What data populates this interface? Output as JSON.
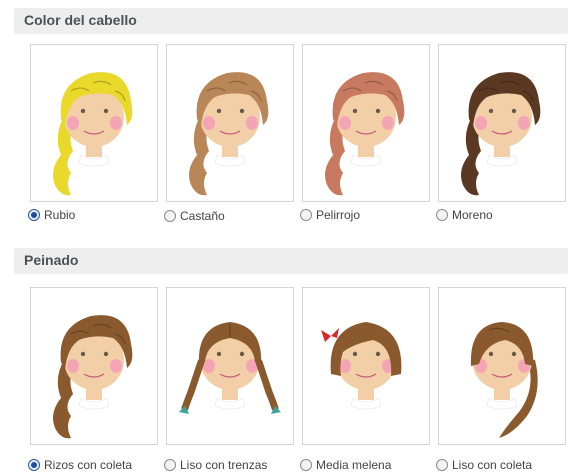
{
  "sections": [
    {
      "title": "Color del cabello",
      "options": [
        {
          "label": "Rubio",
          "selected": true,
          "hair_color": "#e9d92a"
        },
        {
          "label": "Castaño",
          "selected": false,
          "hair_color": "#b98757"
        },
        {
          "label": "Pelirrojo",
          "selected": false,
          "hair_color": "#c87a60"
        },
        {
          "label": "Moreno",
          "selected": false,
          "hair_color": "#5a3822"
        }
      ]
    },
    {
      "title": "Peinado",
      "options": [
        {
          "label": "Rizos con coleta",
          "selected": true,
          "style": "curly-ponytail"
        },
        {
          "label": "Liso con trenzas",
          "selected": false,
          "style": "braids"
        },
        {
          "label": "Media melena",
          "selected": false,
          "style": "bob"
        },
        {
          "label": "Liso con coleta",
          "selected": false,
          "style": "straight-ponytail"
        }
      ]
    }
  ],
  "colors": {
    "skin": "#f2cfa6",
    "cheeks": "#f3a5b6",
    "header_bg": "#eeeeee",
    "header_text": "#4d5056",
    "radio_selected": "#1f4e9e",
    "peinado_hair": "#8a5a2e",
    "braid_ties": "#3ea39a",
    "bow": "#d62a2a"
  },
  "icons": [
    "radio-selected",
    "radio-unselected"
  ]
}
